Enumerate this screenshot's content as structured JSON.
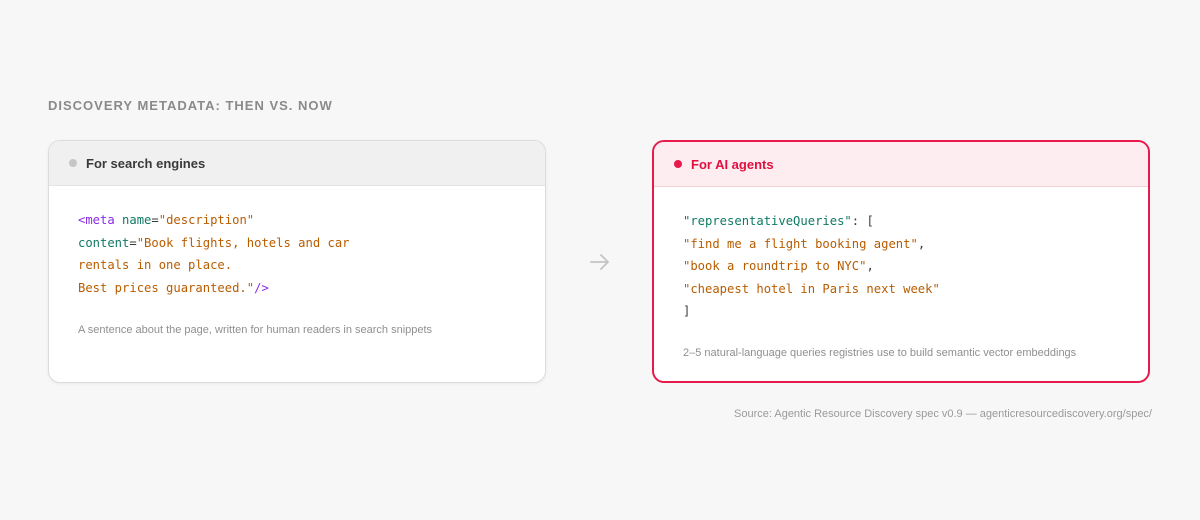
{
  "heading": "DISCOVERY METADATA: THEN VS. NOW",
  "left_card": {
    "title": "For search engines",
    "code": {
      "line1_open": "<meta ",
      "line1_attr": "name",
      "line1_eq": "=",
      "line1_value": "\"description\"",
      "line2_attr": "content",
      "line2_eq": "=",
      "line2_value": "\"Book flights, hotels and car",
      "line3_value": "rentals in one place.",
      "line4_value": "Best prices guaranteed.\"",
      "line4_close": "/>"
    },
    "caption": "A sentence about the page, written for human readers in search snippets"
  },
  "right_card": {
    "title": "For AI agents",
    "code": {
      "key": "\"representativeQueries\"",
      "key_suffix": ": [",
      "query1": "\"find me a flight booking agent\"",
      "query1_suffix": ",",
      "query2": "\"book a roundtrip to NYC\"",
      "query2_suffix": ",",
      "query3": "\"cheapest hotel in Paris next week\"",
      "close": "]"
    },
    "caption": "2–5 natural-language queries registries use to build semantic vector embeddings"
  },
  "arrow_icon": "arrow-right-icon",
  "source": "Source: Agentic Resource Discovery spec v0.9 — agenticresourcediscovery.org/spec/",
  "colors": {
    "accent": "#e8194b",
    "string": "#b85c00",
    "attribute": "#0f7a64",
    "tag": "#8a2be2"
  }
}
